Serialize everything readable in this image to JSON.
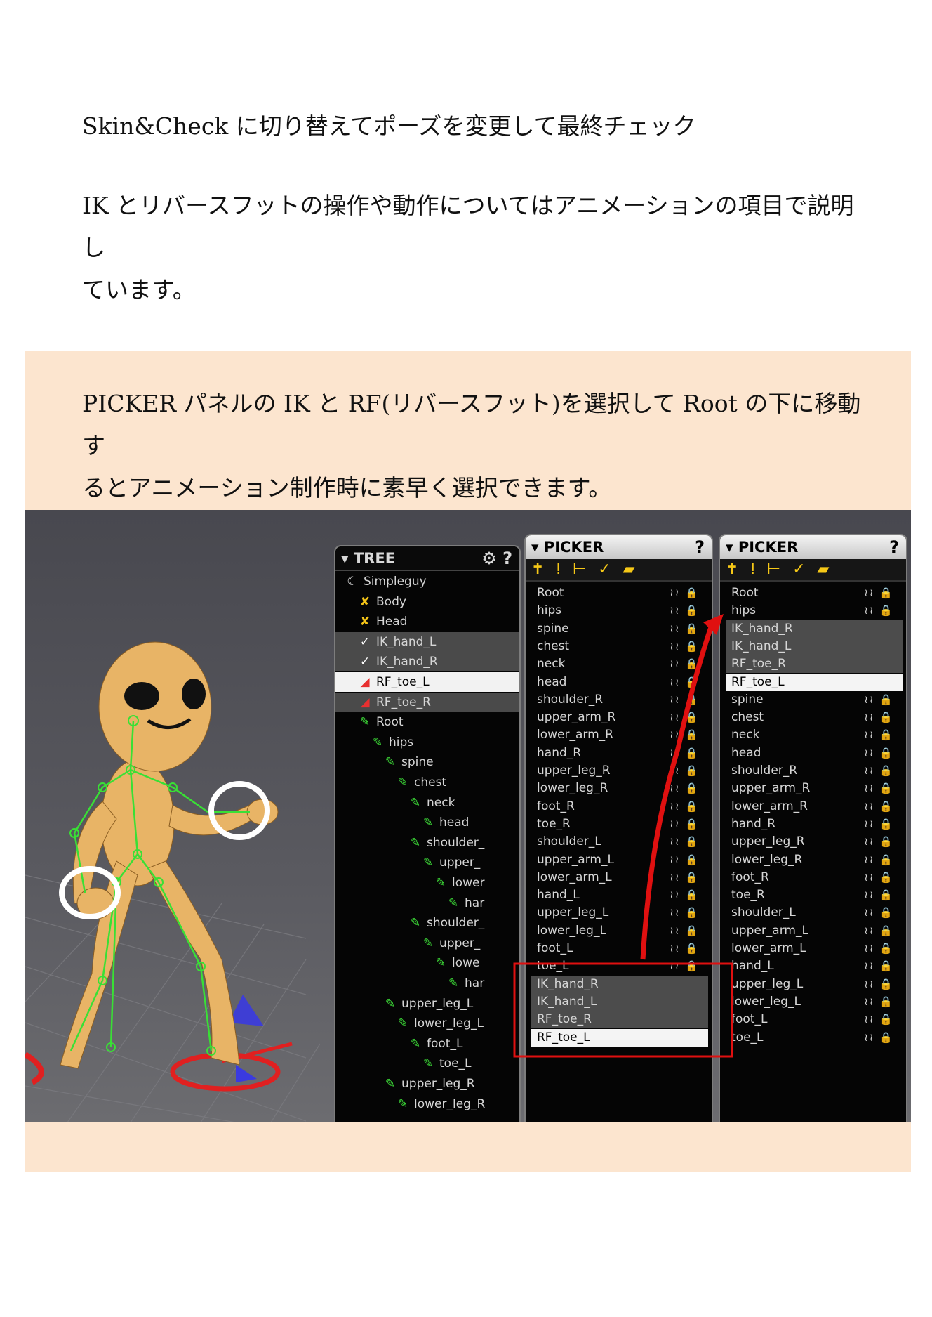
{
  "para1": "Skin&Check に切り替えてポーズを変更して最終チェック",
  "para2_line1": "IK とリバースフットの操作や動作についてはアニメーションの項目で説明し",
  "para2_line2": "ています。",
  "para3_line1": "PICKER パネルの IK と RF(リバースフット)を選択して Root の下に移動す",
  "para3_line2": "るとアニメーション制作時に素早く選択できます。",
  "tree": {
    "title": "▾ TREE",
    "settings_icon": "gear-icon",
    "help": "?",
    "rows": [
      {
        "label": "Simpleguy",
        "icon": "character-icon",
        "style": "",
        "indent": 0
      },
      {
        "label": "Body",
        "icon": "mesh-icon",
        "style": "",
        "indent": 1
      },
      {
        "label": "Head",
        "icon": "mesh-icon",
        "style": "",
        "indent": 1
      },
      {
        "label": "IK_hand_L",
        "icon": "ik-icon",
        "style": "gray",
        "indent": 1
      },
      {
        "label": "IK_hand_R",
        "icon": "ik-icon",
        "style": "gray",
        "indent": 1
      },
      {
        "label": "RF_toe_L",
        "icon": "foot-icon",
        "style": "white",
        "indent": 1
      },
      {
        "label": "RF_toe_R",
        "icon": "foot-icon",
        "style": "gray",
        "indent": 1
      },
      {
        "label": "Root",
        "icon": "bone-icon",
        "style": "",
        "indent": 1
      },
      {
        "label": "hips",
        "icon": "bone-icon",
        "style": "",
        "indent": 2
      },
      {
        "label": "spine",
        "icon": "bone-icon",
        "style": "",
        "indent": 3
      },
      {
        "label": "chest",
        "icon": "bone-icon",
        "style": "",
        "indent": 4
      },
      {
        "label": "neck",
        "icon": "bone-icon",
        "style": "",
        "indent": 5
      },
      {
        "label": "head",
        "icon": "bone-icon",
        "style": "",
        "indent": 6
      },
      {
        "label": "shoulder_",
        "icon": "bone-icon",
        "style": "",
        "indent": 5
      },
      {
        "label": "upper_",
        "icon": "bone-icon",
        "style": "",
        "indent": 6
      },
      {
        "label": "lower",
        "icon": "bone-icon",
        "style": "",
        "indent": 7
      },
      {
        "label": "har",
        "icon": "bone-icon",
        "style": "",
        "indent": 8
      },
      {
        "label": "shoulder_",
        "icon": "bone-icon",
        "style": "",
        "indent": 5
      },
      {
        "label": "upper_",
        "icon": "bone-icon",
        "style": "",
        "indent": 6
      },
      {
        "label": "lowe",
        "icon": "bone-icon",
        "style": "",
        "indent": 7
      },
      {
        "label": "har",
        "icon": "bone-icon",
        "style": "",
        "indent": 8
      },
      {
        "label": "upper_leg_L",
        "icon": "bone-icon",
        "style": "",
        "indent": 3
      },
      {
        "label": "lower_leg_L",
        "icon": "bone-icon",
        "style": "",
        "indent": 4
      },
      {
        "label": "foot_L",
        "icon": "bone-icon",
        "style": "",
        "indent": 5
      },
      {
        "label": "toe_L",
        "icon": "bone-icon",
        "style": "",
        "indent": 6
      },
      {
        "label": "upper_leg_R",
        "icon": "bone-icon",
        "style": "",
        "indent": 3
      },
      {
        "label": "lower_leg_R",
        "icon": "bone-icon",
        "style": "",
        "indent": 4
      }
    ]
  },
  "picker1": {
    "title": "▾ PICKER",
    "help": "?",
    "toolbar": "✝ ⵑ ⊢ ✓ ▰",
    "rows": [
      {
        "label": "Root",
        "style": ""
      },
      {
        "label": "hips",
        "style": ""
      },
      {
        "label": "spine",
        "style": ""
      },
      {
        "label": "chest",
        "style": ""
      },
      {
        "label": "neck",
        "style": ""
      },
      {
        "label": "head",
        "style": ""
      },
      {
        "label": "shoulder_R",
        "style": ""
      },
      {
        "label": "upper_arm_R",
        "style": ""
      },
      {
        "label": "lower_arm_R",
        "style": ""
      },
      {
        "label": "hand_R",
        "style": ""
      },
      {
        "label": "upper_leg_R",
        "style": ""
      },
      {
        "label": "lower_leg_R",
        "style": ""
      },
      {
        "label": "foot_R",
        "style": ""
      },
      {
        "label": "toe_R",
        "style": ""
      },
      {
        "label": "shoulder_L",
        "style": ""
      },
      {
        "label": "upper_arm_L",
        "style": ""
      },
      {
        "label": "lower_arm_L",
        "style": ""
      },
      {
        "label": "hand_L",
        "style": ""
      },
      {
        "label": "upper_leg_L",
        "style": ""
      },
      {
        "label": "lower_leg_L",
        "style": ""
      },
      {
        "label": "foot_L",
        "style": ""
      },
      {
        "label": "toe_L",
        "style": ""
      },
      {
        "label": "IK_hand_R",
        "style": "gray"
      },
      {
        "label": "IK_hand_L",
        "style": "gray"
      },
      {
        "label": "RF_toe_R",
        "style": "gray"
      },
      {
        "label": "RF_toe_L",
        "style": "white"
      }
    ]
  },
  "picker2": {
    "title": "▾ PICKER",
    "help": "?",
    "toolbar": "✝ ⵑ ⊢ ✓ ▰",
    "rows": [
      {
        "label": "Root",
        "style": ""
      },
      {
        "label": "hips",
        "style": ""
      },
      {
        "label": "IK_hand_R",
        "style": "gray"
      },
      {
        "label": "IK_hand_L",
        "style": "gray"
      },
      {
        "label": "RF_toe_R",
        "style": "gray"
      },
      {
        "label": "RF_toe_L",
        "style": "white"
      },
      {
        "label": "spine",
        "style": ""
      },
      {
        "label": "chest",
        "style": ""
      },
      {
        "label": "neck",
        "style": ""
      },
      {
        "label": "head",
        "style": ""
      },
      {
        "label": "shoulder_R",
        "style": ""
      },
      {
        "label": "upper_arm_R",
        "style": ""
      },
      {
        "label": "lower_arm_R",
        "style": ""
      },
      {
        "label": "hand_R",
        "style": ""
      },
      {
        "label": "upper_leg_R",
        "style": ""
      },
      {
        "label": "lower_leg_R",
        "style": ""
      },
      {
        "label": "foot_R",
        "style": ""
      },
      {
        "label": "toe_R",
        "style": ""
      },
      {
        "label": "shoulder_L",
        "style": ""
      },
      {
        "label": "upper_arm_L",
        "style": ""
      },
      {
        "label": "lower_arm_L",
        "style": ""
      },
      {
        "label": "hand_L",
        "style": ""
      },
      {
        "label": "upper_leg_L",
        "style": ""
      },
      {
        "label": "lower_leg_L",
        "style": ""
      },
      {
        "label": "foot_L",
        "style": ""
      },
      {
        "label": "toe_L",
        "style": ""
      }
    ]
  },
  "row_visibility_icon": "wave-icon",
  "row_lock_icon": "lock-icon",
  "colors": {
    "band": "#fce5cf",
    "bone": "#3ddc38",
    "highlight_arrow": "#e01010"
  }
}
